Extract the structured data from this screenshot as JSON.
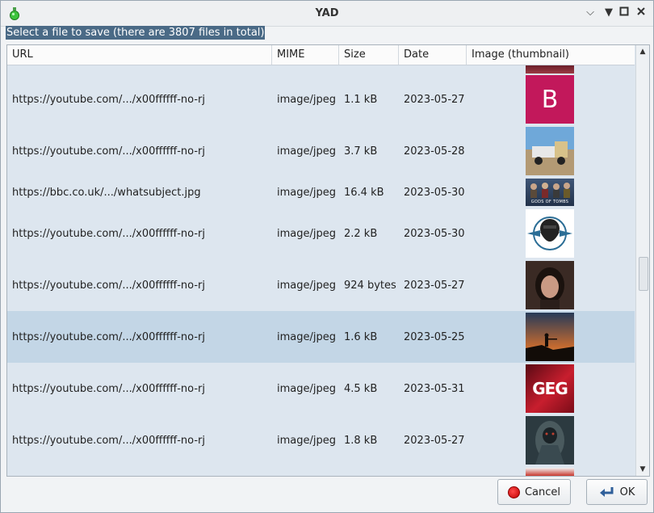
{
  "window": {
    "title": "YAD",
    "controls": [
      "help-icon",
      "minimize-icon",
      "maximize-icon",
      "close-icon"
    ]
  },
  "prompt": "Select a file to save (there are 3807 files in total)",
  "columns": {
    "url": "URL",
    "mime": "MIME",
    "size": "Size",
    "date": "Date",
    "image": "Image (thumbnail)"
  },
  "rows": [
    {
      "url": "https://youtube.com/.../x00ffffff-no-rj",
      "mime": "image/jpeg",
      "size": "1.1  kB",
      "date": "2023-05-27",
      "thumb": "letter-b-avatar",
      "thumb_letter": "B"
    },
    {
      "url": "https://youtube.com/.../x00ffffff-no-rj",
      "mime": "image/jpeg",
      "size": "3.7  kB",
      "date": "2023-05-28",
      "thumb": "truck-photo"
    },
    {
      "url": "https://bbc.co.uk/.../whatsubject.jpg",
      "mime": "image/jpeg",
      "size": "16.4  kB",
      "date": "2023-05-30",
      "thumb": "group-banner",
      "thumb_caption": "GODS OF TOMBS"
    },
    {
      "url": "https://youtube.com/.../x00ffffff-no-rj",
      "mime": "image/jpeg",
      "size": "2.2  kB",
      "date": "2023-05-30",
      "thumb": "bearded-man-logo"
    },
    {
      "url": "https://youtube.com/.../x00ffffff-no-rj",
      "mime": "image/jpeg",
      "size": "924 bytes",
      "date": "2023-05-27",
      "thumb": "woman-portrait"
    },
    {
      "url": "https://youtube.com/.../x00ffffff-no-rj",
      "mime": "image/jpeg",
      "size": "1.6  kB",
      "date": "2023-05-25",
      "thumb": "soldier-sunset",
      "selected": true
    },
    {
      "url": "https://youtube.com/.../x00ffffff-no-rj",
      "mime": "image/jpeg",
      "size": "4.5  kB",
      "date": "2023-05-31",
      "thumb": "geg-logo",
      "thumb_text": "GEG"
    },
    {
      "url": "https://youtube.com/.../x00ffffff-no-rj",
      "mime": "image/jpeg",
      "size": "1.8  kB",
      "date": "2023-05-27",
      "thumb": "dark-creature"
    }
  ],
  "buttons": {
    "cancel": "Cancel",
    "ok": "OK"
  },
  "colors": {
    "selection": "#c3d6e6",
    "list_bg": "#dde6ef",
    "prompt_bg": "#4a6a86",
    "b_avatar": "#c2185b"
  }
}
